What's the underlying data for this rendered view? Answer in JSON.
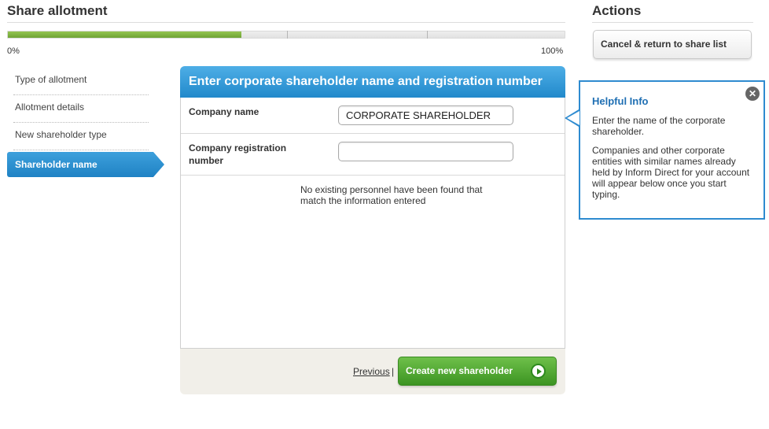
{
  "header": {
    "title": "Share allotment",
    "actions_title": "Actions"
  },
  "progress": {
    "percent": 42,
    "start_label": "0%",
    "end_label": "100%"
  },
  "actions": {
    "cancel_label": "Cancel & return to share list"
  },
  "steps": [
    {
      "label": "Type of allotment",
      "active": false
    },
    {
      "label": "Allotment details",
      "active": false
    },
    {
      "label": "New shareholder type",
      "active": false
    },
    {
      "label": "Shareholder name",
      "active": true
    }
  ],
  "form": {
    "heading": "Enter corporate shareholder name and registration number",
    "company_name_label": "Company name",
    "company_name_value": "CORPORATE SHAREHOLDER",
    "reg_number_label": "Company registration number",
    "reg_number_value": "",
    "no_results_text": "No existing personnel have been found that match the information entered"
  },
  "footer": {
    "previous_label": "Previous",
    "separator": "|",
    "create_label": "Create new shareholder"
  },
  "info": {
    "title": "Helpful Info",
    "close_glyph": "✕",
    "paragraph1": "Enter the name of the corporate shareholder.",
    "paragraph2": "Companies and other corporate entities with similar names already held by Inform Direct for your account will appear below once you start typing."
  },
  "colors": {
    "accent_blue": "#2189cb",
    "progress_green": "#6ea334",
    "create_green": "#3c9422"
  }
}
